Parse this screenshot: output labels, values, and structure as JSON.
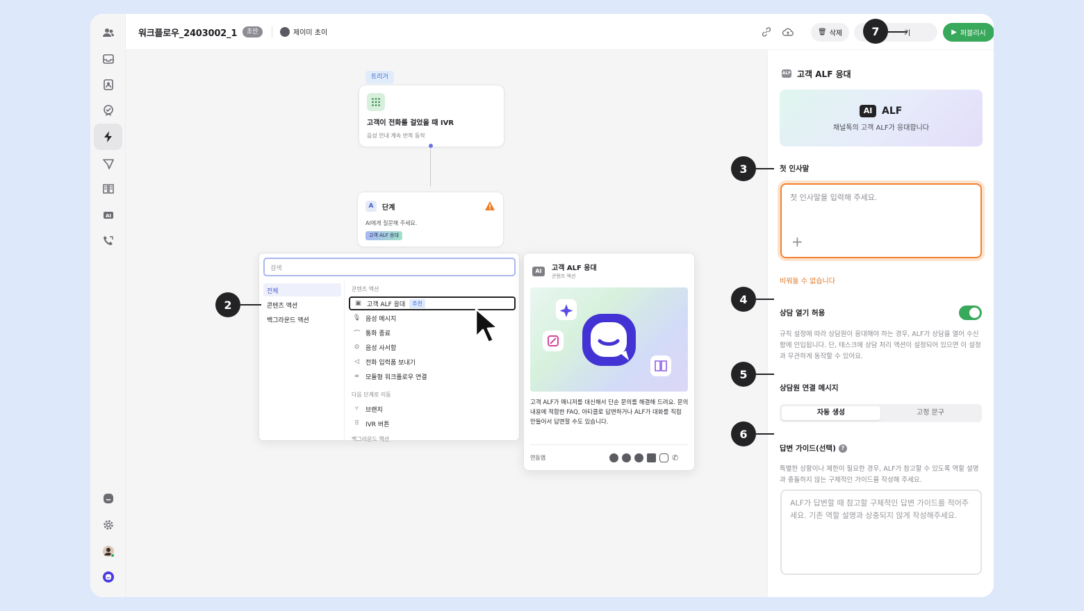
{
  "header": {
    "title": "워크플로우_2403002_1",
    "status_badge": "초안",
    "author": "제이미 초이",
    "delete_label": "삭제",
    "partial_label": "기",
    "publish_label": "퍼블리시"
  },
  "rail": {
    "top_icons": [
      "team-icon",
      "inbox-icon",
      "contacts-icon",
      "badge-check-icon",
      "lightning-icon",
      "send-icon",
      "book-icon",
      "ai-icon",
      "phone-icon"
    ],
    "active": "lightning-icon"
  },
  "canvas": {
    "trigger_tag": "트리거",
    "trigger_node": {
      "title": "고객이 전화를 걸었을 때 IVR",
      "subtitle": "음성 안내 계속 반복 동작"
    },
    "step_node": {
      "letter": "A",
      "title": "단계",
      "subtitle": "AI에게 질문해 주세요.",
      "chip": "고객 ALF 응대"
    }
  },
  "picker": {
    "search_placeholder": "검색",
    "categories": [
      "전체",
      "콘텐츠 액션",
      "백그라운드 액션"
    ],
    "section_content": "콘텐츠 액션",
    "items": [
      {
        "label": "고객 ALF 응대",
        "icon": "ai-icon",
        "badge": "추천"
      },
      {
        "label": "음성 메시지",
        "icon": "mic-icon"
      },
      {
        "label": "통화 종료",
        "icon": "hangup-icon"
      },
      {
        "label": "음성 사서함",
        "icon": "voicemail-icon"
      },
      {
        "label": "전화 입력폼 보내기",
        "icon": "speaker-icon"
      },
      {
        "label": "모듈형 워크플로우 연결",
        "icon": "link-icon"
      }
    ],
    "section_next": "다음 단계로 이동",
    "next_items": [
      {
        "label": "브랜치",
        "icon": "branch-icon"
      },
      {
        "label": "IVR 버튼",
        "icon": "keypad-icon"
      }
    ],
    "section_background_partial": "백그라운드 액션"
  },
  "detail": {
    "title": "고객 ALF 응대",
    "subtitle": "콘텐츠 액션",
    "description": "고객 ALF가 매니저를 대신해서 단순 문의를 해결해 드려요. 문의 내용에 적합한 FAQ, 아티클로 답변하거나 ALF가 대화를 직접 만들어서 답변할 수도 있습니다.",
    "linked_apps_label": "연동앱"
  },
  "panel": {
    "title": "고객 ALF 응대",
    "banner_logo_badge": "AI",
    "banner_logo_text": "ALF",
    "banner_subtitle": "채널톡의 고객 ALF가 응대합니다",
    "greeting_label": "첫 인사말",
    "greeting_placeholder": "첫 인사말을 입력해 주세요.",
    "greeting_error": "비워둘 수 없습니다",
    "allow_label": "상담 열기 허용",
    "allow_on": true,
    "allow_help": "규칙 설정에 따라 상담원이 응대해야 하는 경우, ALF가 상담을 열어 수신함에 인입됩니다. 단, 태스크에 상담 처리 액션이 설정되어 있으면 이 설정과 무관하게 동작할 수 있어요.",
    "agent_msg_label": "상담원 연결 메시지",
    "seg_auto": "자동 생성",
    "seg_fixed": "고정 문구",
    "guide_label": "답변 가이드(선택)",
    "guide_help": "특별한 상황이나 제한이 필요한 경우, ALF가 참고할 수 있도록 역할 설명과 충돌하지 않는 구체적인 가이드를 작성해 주세요.",
    "guide_placeholder": "ALF가 답변할 때 참고할 구체적인 답변 가이드를 적어주세요. 기존 역할 설명과 상충되지 않게 작성해주세요."
  },
  "callouts": [
    "2",
    "3",
    "4",
    "5",
    "6",
    "7"
  ],
  "colors": {
    "accent_green": "#38a85a",
    "error_orange": "#f2802f",
    "badge_dark": "#232326"
  }
}
